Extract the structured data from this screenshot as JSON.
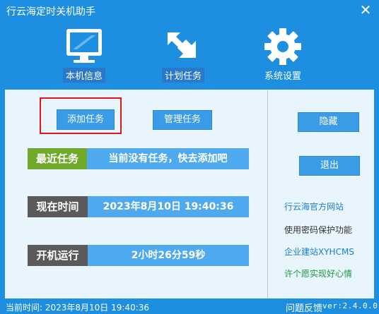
{
  "app": {
    "title": "行云海定时关机助手",
    "close_symbol": "✕"
  },
  "toolbar": {
    "items": [
      {
        "label": "本机信息",
        "icon": "monitor-icon",
        "active": true
      },
      {
        "label": "计划任务",
        "icon": "arrows-icon",
        "active": true
      },
      {
        "label": "系统设置",
        "icon": "gear-icon",
        "active": false
      }
    ]
  },
  "actions": {
    "add_task": "添加任务",
    "manage_tasks": "管理任务",
    "hide": "隐藏",
    "exit": "退出"
  },
  "info": {
    "recent_task_label": "最近任务",
    "recent_task_value": "当前没有任务，快去添加吧",
    "current_time_label": "现在时间",
    "current_time_value": "2023年8月10日  19:40:36",
    "uptime_label": "开机运行",
    "uptime_value": "2小时26分59秒"
  },
  "links": {
    "official_site": "行云海官方网站",
    "password_protect": "使用密码保护功能",
    "enterprise_site": "企业建站XYHCMS",
    "wish": "许个愿实现好心情"
  },
  "status": {
    "current_time": "当前时间: 2023年8月10日 19:40:36",
    "feedback": "问题反馈",
    "version": "ver:2.4.0.0"
  },
  "colors": {
    "window_blue": "#1e8fe0",
    "panel_bg": "#e8f5fc",
    "button_blue": "#3a9be6",
    "recent_green": "#6ea92a",
    "dark_gray": "#5a5a5a",
    "link_blue": "#1a7fd4",
    "link_green": "#1e9b3c",
    "focus_red": "#e5131a"
  }
}
